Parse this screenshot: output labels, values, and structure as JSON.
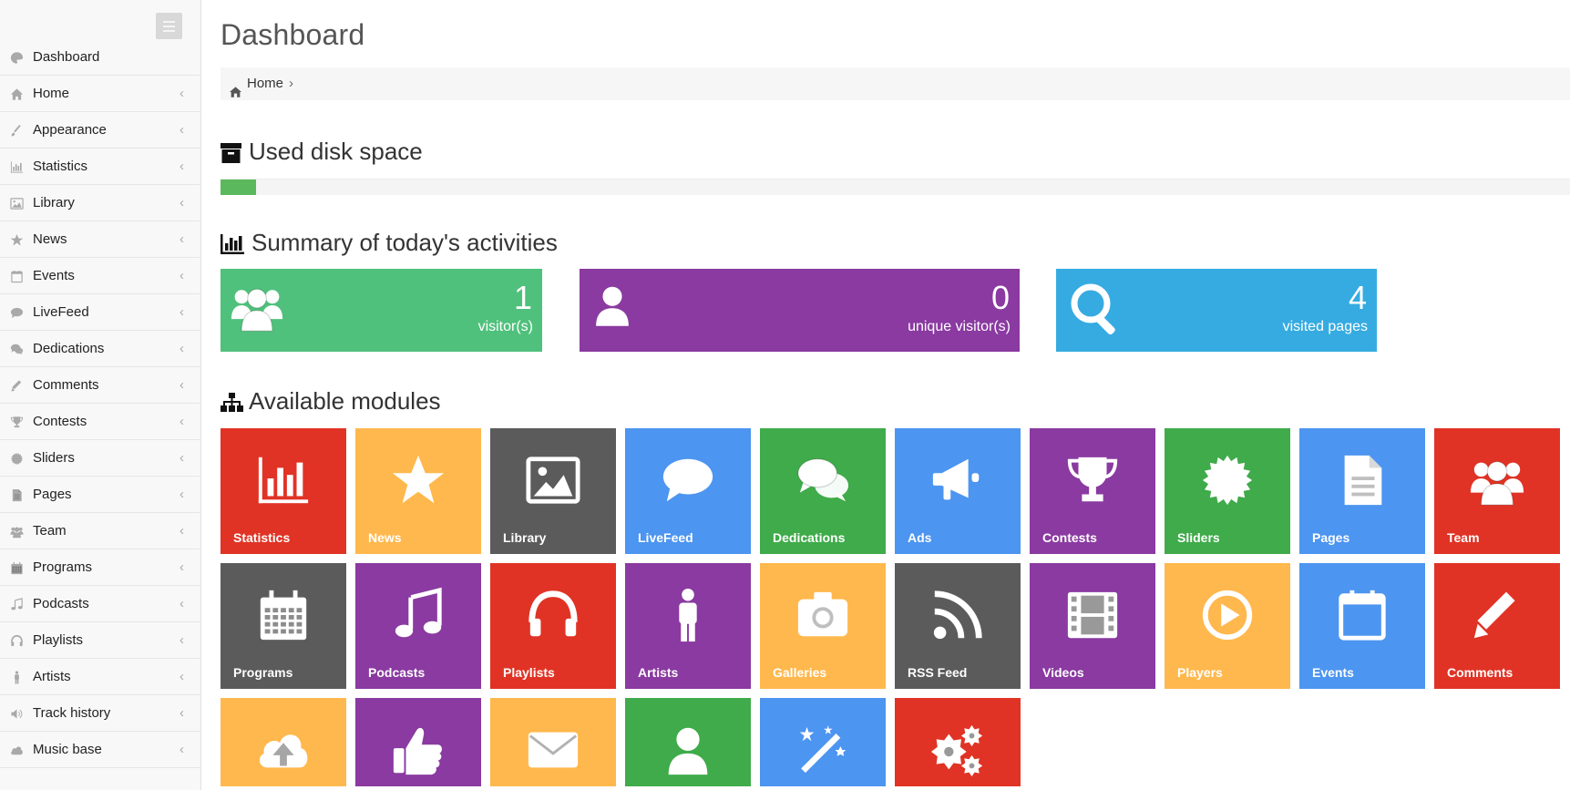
{
  "sidebar": {
    "items": [
      {
        "label": "Dashboard",
        "icon": "palette-icon"
      },
      {
        "label": "Home",
        "icon": "home-icon"
      },
      {
        "label": "Appearance",
        "icon": "brush-icon"
      },
      {
        "label": "Statistics",
        "icon": "bar-chart-icon"
      },
      {
        "label": "Library",
        "icon": "image-icon"
      },
      {
        "label": "News",
        "icon": "star-icon"
      },
      {
        "label": "Events",
        "icon": "calendar-icon"
      },
      {
        "label": "LiveFeed",
        "icon": "comment-icon"
      },
      {
        "label": "Dedications",
        "icon": "comments-icon"
      },
      {
        "label": "Comments",
        "icon": "pencil-icon"
      },
      {
        "label": "Contests",
        "icon": "trophy-icon"
      },
      {
        "label": "Sliders",
        "icon": "certificate-icon"
      },
      {
        "label": "Pages",
        "icon": "file-icon"
      },
      {
        "label": "Team",
        "icon": "users-icon"
      },
      {
        "label": "Programs",
        "icon": "calendar-grid-icon"
      },
      {
        "label": "Podcasts",
        "icon": "music-icon"
      },
      {
        "label": "Playlists",
        "icon": "headphones-icon"
      },
      {
        "label": "Artists",
        "icon": "person-icon"
      },
      {
        "label": "Track history",
        "icon": "volume-icon"
      },
      {
        "label": "Music base",
        "icon": "cloud-icon"
      }
    ],
    "chevron": "‹"
  },
  "header": {
    "title": "Dashboard"
  },
  "breadcrumb": {
    "home": "Home",
    "separator": "›"
  },
  "disk": {
    "title": "Used disk space",
    "used_fraction": 0.026,
    "color": "#5cb85c"
  },
  "summary": {
    "title": "Summary of today's activities",
    "boxes": [
      {
        "value": "1",
        "caption": "visitor(s)",
        "color": "#4fc17c",
        "icon": "users-icon"
      },
      {
        "value": "0",
        "caption": "unique visitor(s)",
        "color": "#8a3aa0",
        "icon": "user-icon"
      },
      {
        "value": "4",
        "caption": "visited pages",
        "color": "#36abe1",
        "icon": "search-icon"
      }
    ]
  },
  "modules": {
    "title": "Available modules",
    "tiles": [
      {
        "label": "Statistics",
        "color": "#e03325",
        "icon": "bar-chart-icon"
      },
      {
        "label": "News",
        "color": "#ffb84d",
        "icon": "star-icon"
      },
      {
        "label": "Library",
        "color": "#5b5b5b",
        "icon": "image-icon"
      },
      {
        "label": "LiveFeed",
        "color": "#4c95f0",
        "icon": "comment-icon"
      },
      {
        "label": "Dedications",
        "color": "#3fab4a",
        "icon": "comments-icon"
      },
      {
        "label": "Ads",
        "color": "#4c95f0",
        "icon": "megaphone-icon"
      },
      {
        "label": "Contests",
        "color": "#8a3aa0",
        "icon": "trophy-icon"
      },
      {
        "label": "Sliders",
        "color": "#3fab4a",
        "icon": "certificate-icon"
      },
      {
        "label": "Pages",
        "color": "#4c95f0",
        "icon": "file-icon"
      },
      {
        "label": "Team",
        "color": "#e03325",
        "icon": "users-icon"
      },
      {
        "label": "Programs",
        "color": "#5b5b5b",
        "icon": "calendar-grid-icon"
      },
      {
        "label": "Podcasts",
        "color": "#8a3aa0",
        "icon": "music-icon"
      },
      {
        "label": "Playlists",
        "color": "#e03325",
        "icon": "headphones-icon"
      },
      {
        "label": "Artists",
        "color": "#8a3aa0",
        "icon": "person-icon"
      },
      {
        "label": "Galleries",
        "color": "#ffb84d",
        "icon": "camera-icon"
      },
      {
        "label": "RSS Feed",
        "color": "#5b5b5b",
        "icon": "rss-icon"
      },
      {
        "label": "Videos",
        "color": "#8a3aa0",
        "icon": "film-icon"
      },
      {
        "label": "Players",
        "color": "#ffb84d",
        "icon": "play-circle-icon"
      },
      {
        "label": "Events",
        "color": "#4c95f0",
        "icon": "calendar-icon"
      },
      {
        "label": "Comments",
        "color": "#e03325",
        "icon": "pencil-icon"
      },
      {
        "label": "",
        "color": "#ffb84d",
        "icon": "cloud-upload-icon"
      },
      {
        "label": "",
        "color": "#8a3aa0",
        "icon": "thumbs-up-icon"
      },
      {
        "label": "",
        "color": "#ffb84d",
        "icon": "envelope-icon"
      },
      {
        "label": "",
        "color": "#3fab4a",
        "icon": "user-icon"
      },
      {
        "label": "",
        "color": "#4c95f0",
        "icon": "magic-wand-icon"
      },
      {
        "label": "",
        "color": "#e03325",
        "icon": "gears-icon"
      }
    ]
  }
}
